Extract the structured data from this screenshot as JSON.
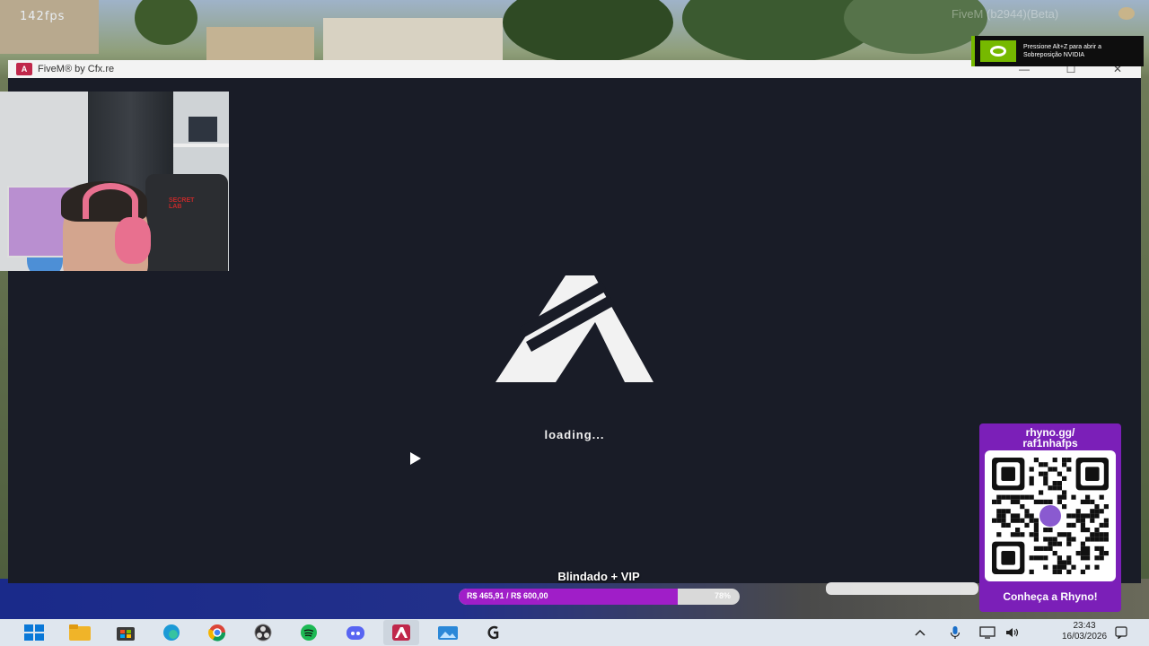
{
  "overlay": {
    "fps": "142fps",
    "version": "FiveM (b2944)(Beta)"
  },
  "nvidia_toast": {
    "text": "Pressione Alt+Z para abrir a Sobreposição NVIDIA",
    "accent": "#76b900"
  },
  "window": {
    "title": "FiveM® by Cfx.re",
    "icon": "fivem-app-icon",
    "controls": [
      "—",
      "☐",
      "✕"
    ],
    "background": "#191c27"
  },
  "loader": {
    "status": "loading..."
  },
  "goal": {
    "title": "Blindado + VIP",
    "amount": "R$ 465,91 / R$ 600,00",
    "percent_label": "78%",
    "progress": 0.78,
    "fill_color": "#a01ec8"
  },
  "rhyno": {
    "url": "rhyno.gg/\nraf1nhafps",
    "cta": "Conheça a Rhyno!",
    "color": "#7b1fb8"
  },
  "taskbar": {
    "apps": [
      "windows-start-icon",
      "file-explorer-icon",
      "microsoft-store-icon",
      "edge-icon",
      "chrome-icon",
      "obs-icon",
      "spotify-icon",
      "discord-icon",
      "fivem-icon",
      "photos-icon",
      "logitech-ghub-icon"
    ],
    "tray": [
      "chevron-up-icon",
      "microphone-icon",
      "monitor-icon",
      "volume-icon"
    ],
    "time": "23:43",
    "date": "16/03/2026"
  }
}
